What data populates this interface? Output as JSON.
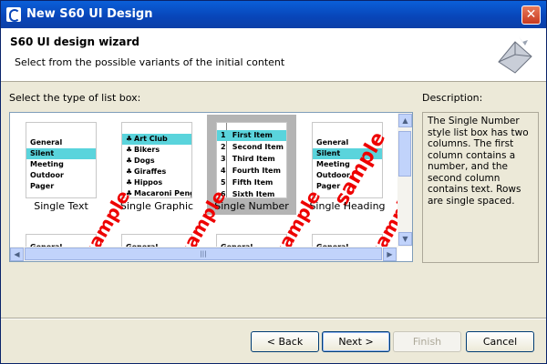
{
  "window": {
    "title": "New S60 UI Design",
    "close_glyph": "✕"
  },
  "header": {
    "title": "S60 UI design wizard",
    "subtitle": "Select from the possible variants of the initial content",
    "icon": "envelope-wizard-icon"
  },
  "main": {
    "section_label": "Select the type of list box:",
    "description_label": "Description:",
    "description_text": "The Single Number style list box has two columns. The first column contains a number, and the second column contains text. Rows are single spaced.",
    "sample_watermark": "sample",
    "gallery_row1": [
      {
        "caption": "Single Text",
        "rows": [
          "General",
          "Silent",
          "Meeting",
          "Outdoor",
          "Pager"
        ],
        "highlight": 1
      },
      {
        "caption": "Single Graphic",
        "rows": [
          "Art Club",
          "Bikers",
          "Dogs",
          "Giraffes",
          "Hippos",
          "Macaroni Penguine..."
        ],
        "highlight": 0
      },
      {
        "caption": "Single Number",
        "rows": [
          "First Item",
          "Second Item",
          "Third Item",
          "Fourth Item",
          "Fifth Item",
          "Sixth Item"
        ],
        "numbers": [
          "1",
          "2",
          "3",
          "4",
          "5",
          "6"
        ],
        "highlight": 0
      },
      {
        "caption": "Single Heading",
        "rows": [
          "General",
          "Silent",
          "Meeting",
          "Outdoor",
          "Pager"
        ],
        "highlight": 1
      }
    ],
    "gallery_row2": [
      "General",
      "General",
      "General",
      "General"
    ],
    "hscroll_grip": "|||"
  },
  "footer": {
    "back_label": "< Back",
    "next_label": "Next >",
    "finish_label": "Finish",
    "cancel_label": "Cancel"
  },
  "colors": {
    "highlight": "#5ad4dc",
    "selected_bg": "#b4b4b4",
    "title_bar": "#0845b8",
    "watermark": "#e00000"
  }
}
